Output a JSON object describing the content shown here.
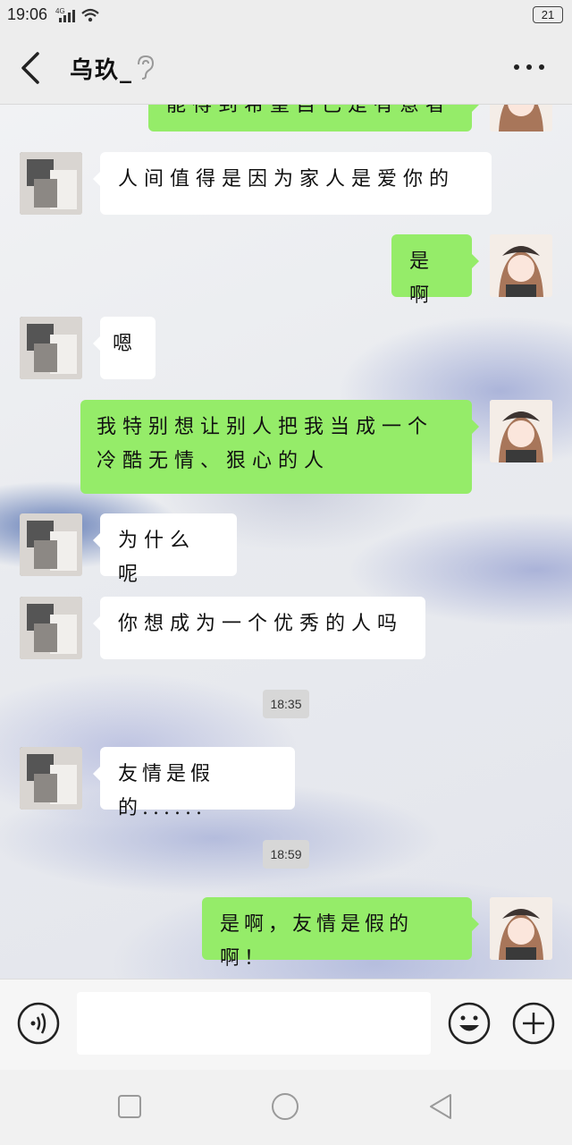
{
  "status_bar": {
    "time": "19:06",
    "signal": "4G",
    "battery": "21"
  },
  "header": {
    "title": "乌玖_"
  },
  "messages": [
    {
      "from": "me",
      "text": "能得到希望自己是有意者"
    },
    {
      "from": "friend",
      "text": "人间值得是因为家人是爱你的"
    },
    {
      "from": "me",
      "text": "是啊"
    },
    {
      "from": "friend",
      "text": "嗯"
    },
    {
      "from": "me",
      "text": "我特别想让别人把我当成一个冷酷无情、狠心的人"
    },
    {
      "from": "friend",
      "text": "为什么呢"
    },
    {
      "from": "friend",
      "text": "你想成为一个优秀的人吗"
    },
    {
      "time": "18:35"
    },
    {
      "from": "friend",
      "text": "友情是假的......"
    },
    {
      "time": "18:59"
    },
    {
      "from": "me",
      "text": "是啊，友情是假的啊！"
    }
  ],
  "input": {
    "placeholder": ""
  },
  "icons": {
    "back": "chevron-left-icon",
    "more": "more-icon",
    "ear": "ear-icon",
    "voice": "voice-icon",
    "emoji": "emoji-icon",
    "add": "plus-icon",
    "nav_recent": "square-icon",
    "nav_home": "circle-icon",
    "nav_back": "triangle-icon"
  },
  "colors": {
    "my_bubble": "#95ec69",
    "friend_bubble": "#ffffff",
    "bar": "#ededed"
  }
}
